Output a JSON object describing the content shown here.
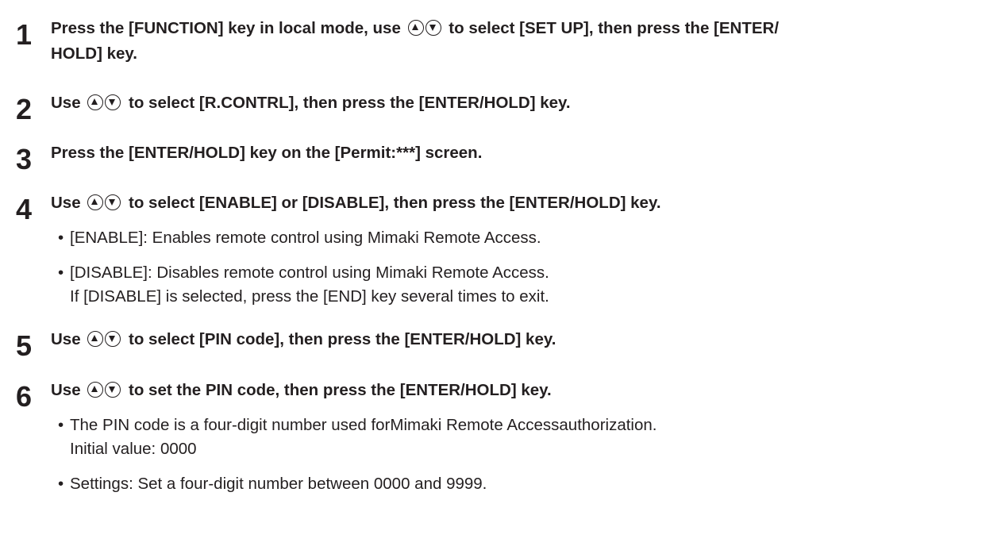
{
  "steps": [
    {
      "number": "1",
      "before": "Press the [FUNCTION] key in local mode, use",
      "after": "to select [SET UP], then press the [ENTER/",
      "line2": "HOLD] key."
    },
    {
      "number": "2",
      "before": "Use",
      "after": "to select [R.CONTRL], then press the [ENTER/HOLD] key."
    },
    {
      "number": "3",
      "text": "Press the [ENTER/HOLD] key on the [Permit:***] screen."
    },
    {
      "number": "4",
      "before": "Use",
      "after": "to select [ENABLE] or [DISABLE], then press the [ENTER/HOLD] key.",
      "bullets": [
        {
          "lines": [
            "[ENABLE]: Enables remote control using Mimaki Remote Access."
          ]
        },
        {
          "lines": [
            "[DISABLE]: Disables remote control using Mimaki Remote Access.",
            "If [DISABLE] is selected, press the [END] key several times to exit."
          ]
        }
      ]
    },
    {
      "number": "5",
      "before": "Use",
      "after": "to select [PIN code], then press the [ENTER/HOLD] key."
    },
    {
      "number": "6",
      "before": "Use",
      "after": "to set the PIN code, then press the [ENTER/HOLD] key.",
      "bullets": [
        {
          "lines": [
            "The PIN code is a four-digit number used forMimaki Remote Accessauthorization.",
            "Initial value: 0000"
          ]
        },
        {
          "lines": [
            "Settings: Set a four-digit number between 0000 and 9999."
          ]
        }
      ]
    }
  ],
  "bullet_symbol": "•",
  "icons": {
    "up": "up-arrow-key-icon",
    "down": "down-arrow-key-icon"
  }
}
